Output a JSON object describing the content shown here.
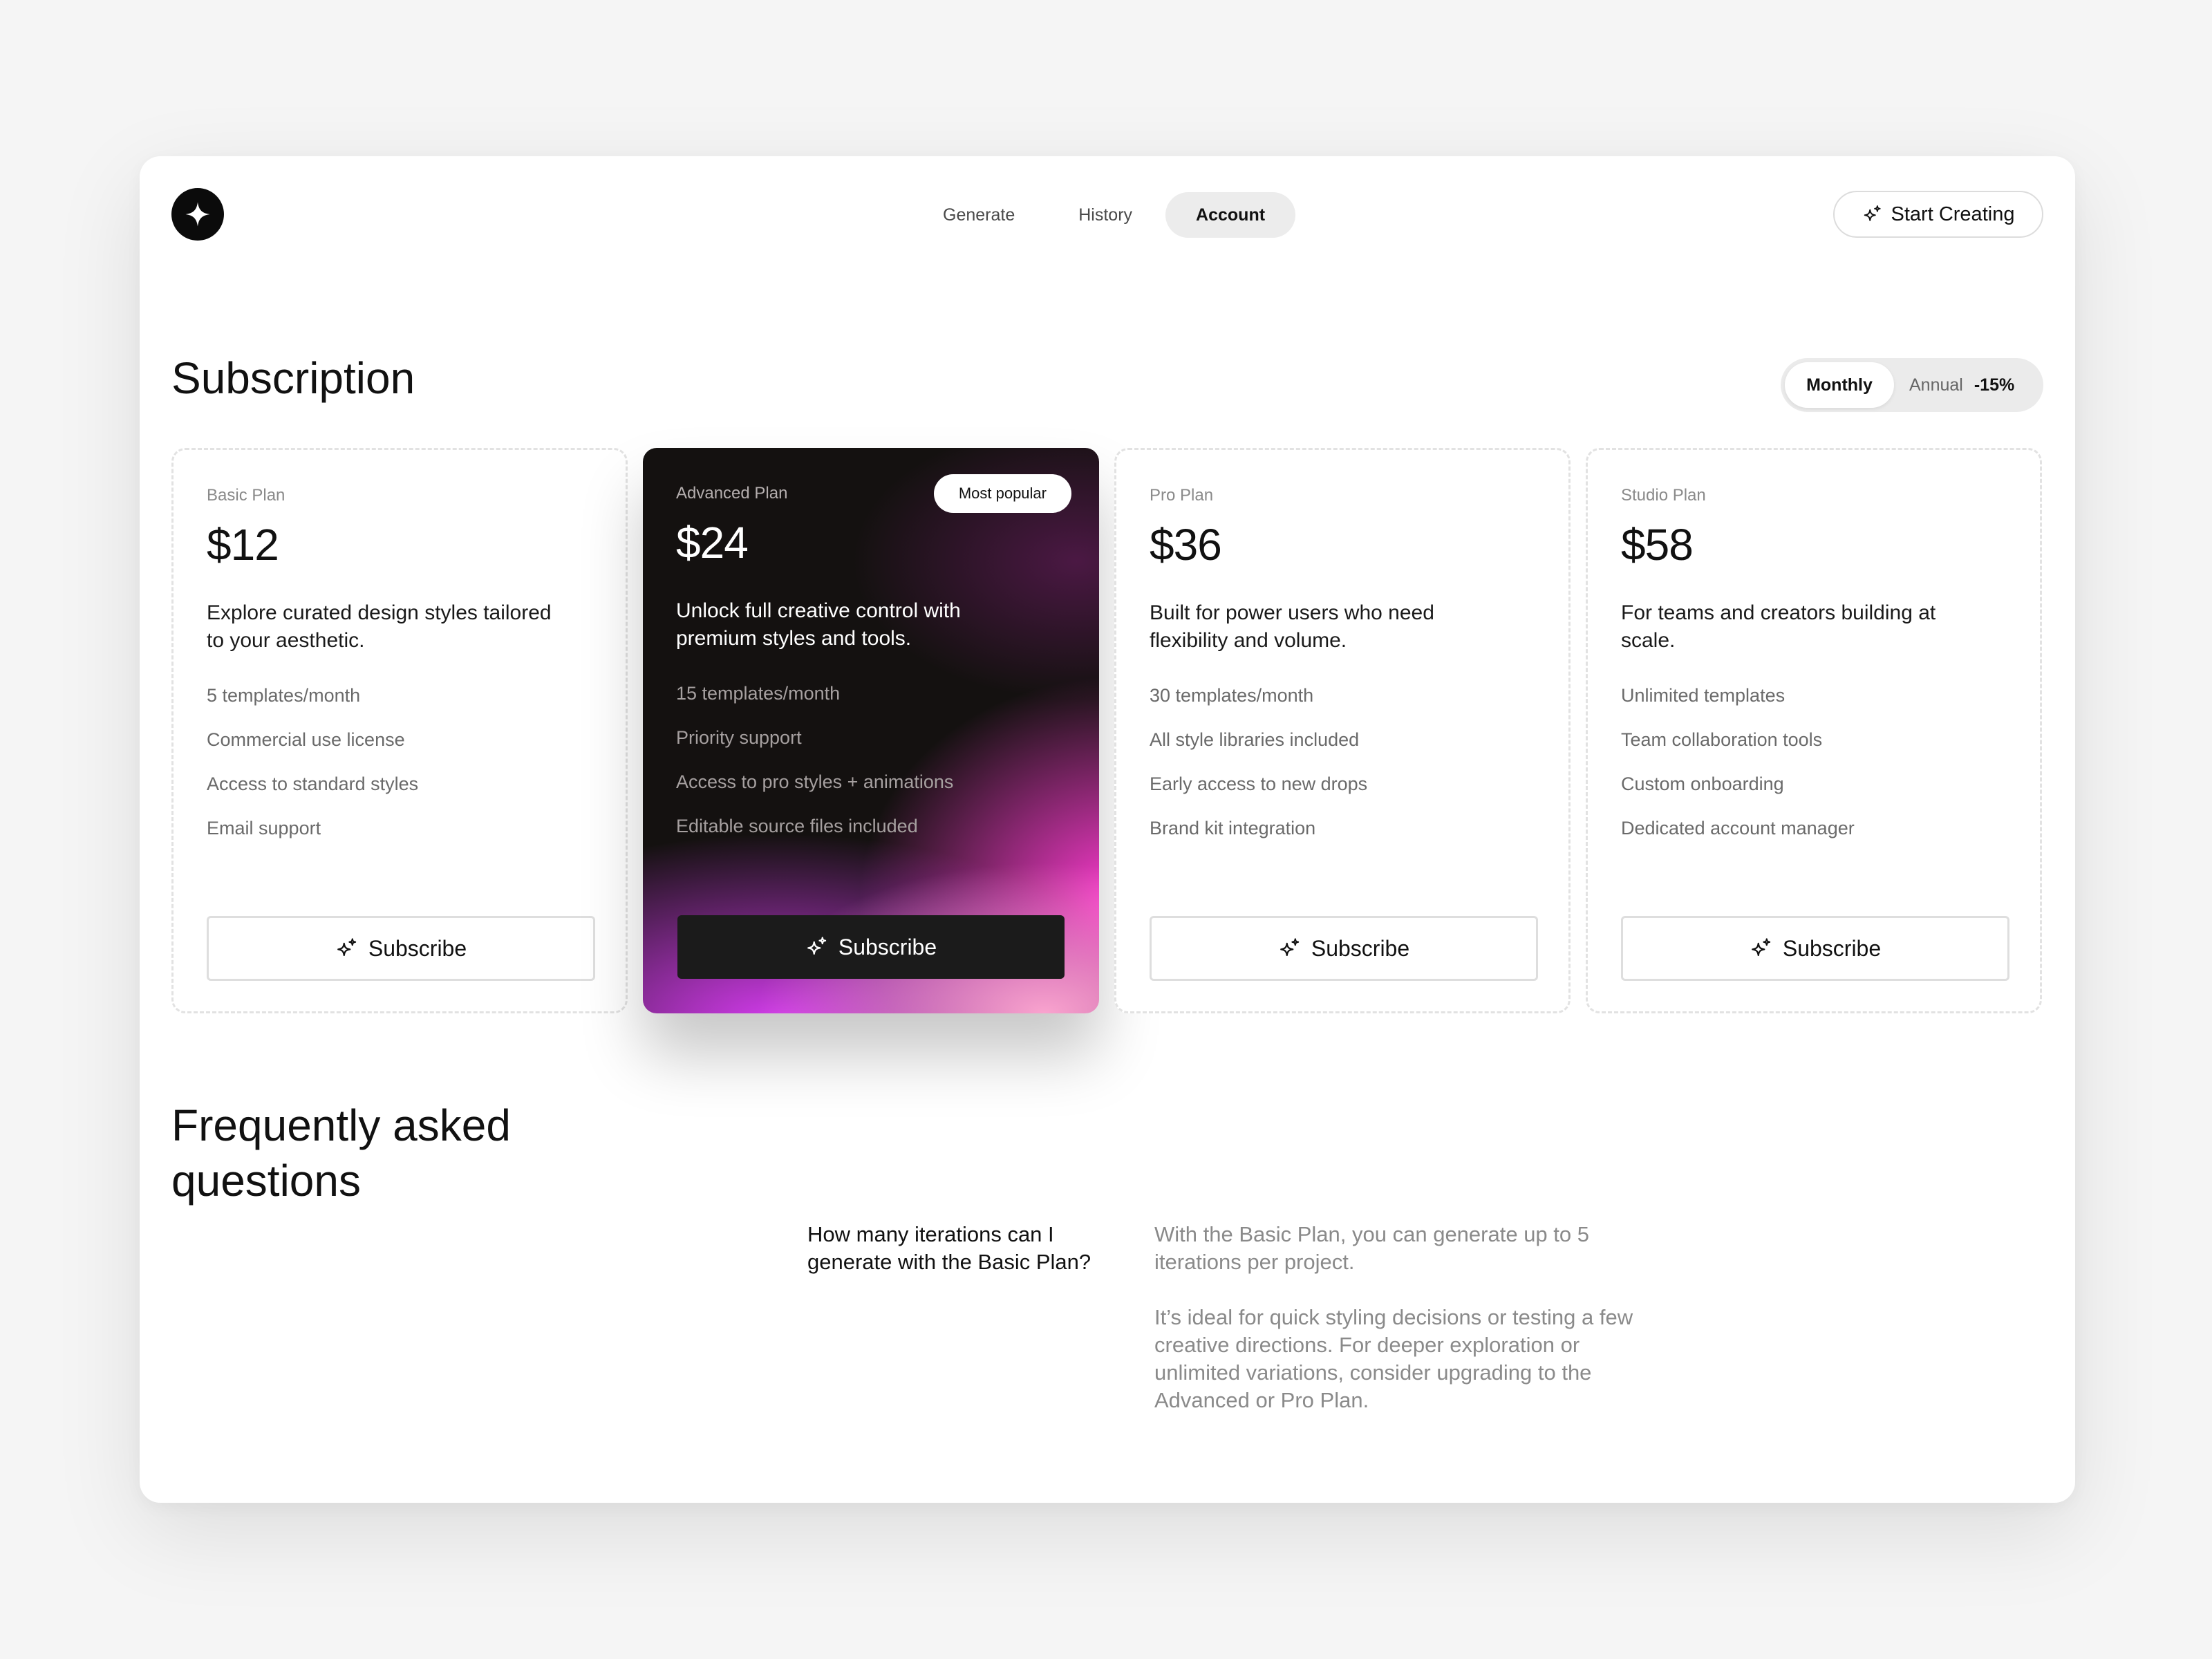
{
  "header": {
    "nav": [
      {
        "label": "Generate"
      },
      {
        "label": "History"
      },
      {
        "label": "Account",
        "active": true
      }
    ],
    "cta_label": "Start Creating"
  },
  "subscription": {
    "title": "Subscription",
    "billing": {
      "monthly_label": "Monthly",
      "annual_label": "Annual",
      "annual_discount": "-15%",
      "selected": "Monthly"
    }
  },
  "plans": [
    {
      "name": "Basic Plan",
      "price": "$12",
      "description": "Explore curated design styles tailored to your aesthetic.",
      "features": [
        "5 templates/month",
        "Commercial use license",
        "Access to standard styles",
        "Email support"
      ],
      "button": "Subscribe"
    },
    {
      "name": "Advanced Plan",
      "badge": "Most popular",
      "price": "$24",
      "description": "Unlock full creative control with premium styles and tools.",
      "features": [
        "15 templates/month",
        "Priority support",
        "Access to pro styles + animations",
        "Editable source files included"
      ],
      "button": "Subscribe"
    },
    {
      "name": "Pro Plan",
      "price": "$36",
      "description": "Built for power users who need flexibility and volume.",
      "features": [
        "30 templates/month",
        "All style libraries included",
        "Early access to new drops",
        "Brand kit integration"
      ],
      "button": "Subscribe"
    },
    {
      "name": "Studio Plan",
      "price": "$58",
      "description": "For teams and creators building at scale.",
      "features": [
        "Unlimited templates",
        "Team collaboration tools",
        "Custom onboarding",
        "Dedicated account manager"
      ],
      "button": "Subscribe"
    }
  ],
  "faq": {
    "title": "Frequently asked questions",
    "items": [
      {
        "question": "How many iterations can I generate with the Basic Plan?",
        "answer": [
          "With the Basic Plan, you can generate up to 5 iterations per project.",
          "It’s ideal for quick styling decisions or testing a few creative directions. For deeper exploration or unlimited variations, consider upgrading to the Advanced or Pro Plan."
        ]
      }
    ]
  },
  "icons": {
    "logo": "sparkle-icon",
    "buttons": "sparkles-icon"
  },
  "colors": {
    "featured_card_base": "#141110",
    "featured_accent_magenta": "#ff3cd2",
    "featured_accent_violet": "#d63cf0",
    "page_background": "#f5f5f5"
  }
}
